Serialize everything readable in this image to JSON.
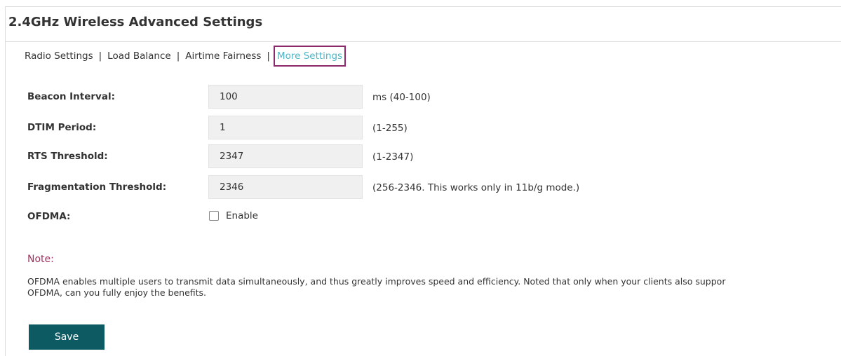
{
  "header": {
    "title": "2.4GHz Wireless Advanced Settings"
  },
  "tabs": [
    {
      "label": "Radio Settings",
      "active": false
    },
    {
      "label": "Load Balance",
      "active": false
    },
    {
      "label": "Airtime Fairness",
      "active": false
    },
    {
      "label": "More Settings",
      "active": true
    }
  ],
  "tab_separator": "|",
  "form": {
    "beacon_interval": {
      "label": "Beacon Interval:",
      "value": "100",
      "hint": "ms (40-100)"
    },
    "dtim_period": {
      "label": "DTIM Period:",
      "value": "1",
      "hint": "(1-255)"
    },
    "rts_threshold": {
      "label": "RTS Threshold:",
      "value": "2347",
      "hint": "(1-2347)"
    },
    "fragmentation_threshold": {
      "label": "Fragmentation Threshold:",
      "value": "2346",
      "hint": "(256-2346. This works only in 11b/g mode.)"
    },
    "ofdma": {
      "label": "OFDMA:",
      "checkbox_label": "Enable",
      "checked": false
    }
  },
  "note": {
    "title": "Note:",
    "line1": "OFDMA enables multiple users to transmit data simultaneously, and thus greatly improves speed and efficiency. Noted that only when your clients also suppor",
    "line2": "OFDMA, can you fully enjoy the benefits."
  },
  "actions": {
    "save_label": "Save"
  },
  "colors": {
    "active_tab_text": "#4fb5c7",
    "active_tab_border": "#8b2a6b",
    "note_title": "#a0325f",
    "save_button": "#0e5a63"
  }
}
